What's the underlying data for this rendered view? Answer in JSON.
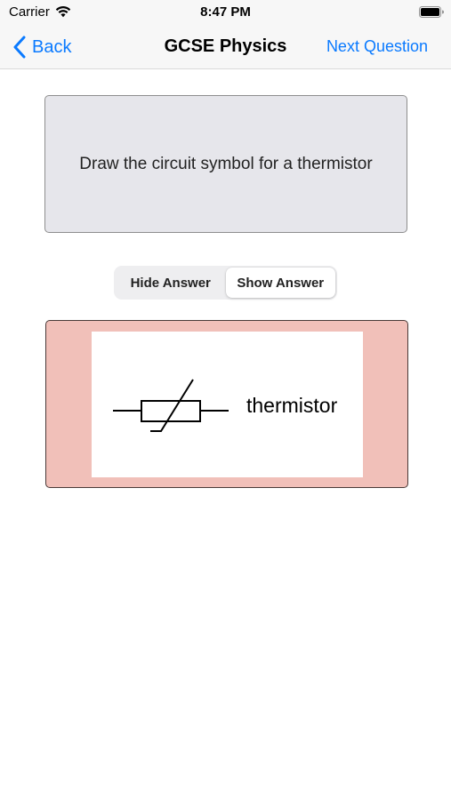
{
  "status_bar": {
    "carrier": "Carrier",
    "time": "8:47 PM",
    "wifi_icon": "wifi-icon",
    "battery_icon": "battery-icon"
  },
  "nav": {
    "back_label": "Back",
    "title": "GCSE Physics",
    "next_label": "Next Question",
    "accent_color": "#0a7aff"
  },
  "question": {
    "text": "Draw the circuit symbol for a thermistor"
  },
  "answer_toggle": {
    "options": [
      "Hide Answer",
      "Show Answer"
    ],
    "selected": "Show Answer"
  },
  "answer": {
    "label": "thermistor",
    "symbol_icon": "thermistor-symbol-icon",
    "card_color": "#f1c0b9"
  }
}
